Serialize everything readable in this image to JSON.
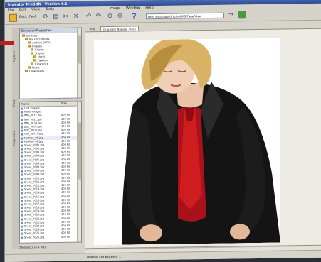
{
  "window": {
    "title": "Ingestor ProSBR - Version 4.1"
  },
  "menu": [
    "File",
    "Edit",
    "View",
    "Tools",
    "Image",
    "Window",
    "Help"
  ],
  "toolbar": {
    "back_label": "Back",
    "forward_label": "Fwd",
    "zoom_value": "Hist: Fit Image Original/MS/Page/View",
    "help_icon": "help-icon"
  },
  "side_tabs": [
    "Explorer",
    "Print",
    "Properties"
  ],
  "tree": {
    "header": "Explorer/Properties",
    "items": [
      "Desktop",
      "My Documents",
      "Archive 2004",
      "Images",
      "Clients",
      "Shoots",
      "Hotel",
      "Fashion",
      "Clearance",
      "Music",
      "Downloads"
    ]
  },
  "files": {
    "columns": [
      "Name",
      "Size"
    ],
    "rows": [
      {
        "name": "Unit Images",
        "size": ""
      },
      {
        "name": "Hotel Images",
        "size": ""
      },
      {
        "name": "IMG_0017.jpg",
        "size": "400 KB"
      },
      {
        "name": "IMG_0021.jpg",
        "size": "400 KB"
      },
      {
        "name": "IMG_0034.jpg",
        "size": "400 KB"
      },
      {
        "name": "Edit_0002.jpg",
        "size": "400 KB"
      },
      {
        "name": "Edit_0003.jpg",
        "size": "400 KB"
      },
      {
        "name": "Clip_00017.jpg",
        "size": "400 KB"
      },
      {
        "name": "Fashion_01.jpg",
        "size": "400 KB"
      },
      {
        "name": "Fashion_02.jpg",
        "size": "400 KB"
      },
      {
        "name": "Shoot_0001.jpg",
        "size": "400 KB"
      },
      {
        "name": "Shoot_0002.jpg",
        "size": "400 KB"
      },
      {
        "name": "Shoot_0003.jpg",
        "size": "400 KB"
      },
      {
        "name": "Shoot_0004.jpg",
        "size": "400 KB"
      },
      {
        "name": "Shoot_0005.jpg",
        "size": "400 KB"
      },
      {
        "name": "Shoot_0006.jpg",
        "size": "400 KB"
      },
      {
        "name": "Shoot_0007.jpg",
        "size": "400 KB"
      },
      {
        "name": "Shoot_0008.jpg",
        "size": "400 KB"
      },
      {
        "name": "Shoot_0009.jpg",
        "size": "400 KB"
      },
      {
        "name": "Shoot_0010.jpg",
        "size": "400 KB"
      },
      {
        "name": "Shoot_0011.jpg",
        "size": "400 KB"
      },
      {
        "name": "Shoot_0012.jpg",
        "size": "400 KB"
      },
      {
        "name": "Shoot_0013.jpg",
        "size": "400 KB"
      },
      {
        "name": "Shoot_0014.jpg",
        "size": "400 KB"
      },
      {
        "name": "Shoot_0015.jpg",
        "size": "400 KB"
      },
      {
        "name": "Shoot_0016.jpg",
        "size": "400 KB"
      },
      {
        "name": "Shoot_0017.jpg",
        "size": "400 KB"
      },
      {
        "name": "Shoot_0018.jpg",
        "size": "400 KB"
      },
      {
        "name": "Shoot_0019.jpg",
        "size": "400 KB"
      },
      {
        "name": "Shoot_0020.jpg",
        "size": "400 KB"
      },
      {
        "name": "Shoot_0021.jpg",
        "size": "400 KB"
      },
      {
        "name": "Shoot_0022.jpg",
        "size": "400 KB"
      },
      {
        "name": "Shoot_0023.jpg",
        "size": "400 KB"
      },
      {
        "name": "Shoot_0024.jpg",
        "size": "400 KB"
      },
      {
        "name": "Shoot_0025.jpg",
        "size": "400 KB"
      },
      {
        "name": "Shoot_0026.jpg",
        "size": "400 KB"
      }
    ]
  },
  "status_left": "36 objects (4.4 MB)",
  "doc_tabs": [
    "Info",
    "Original / Natural / Pics"
  ],
  "status_bar": "Original 4x4 640x480 ...",
  "colors": {
    "accent": "#2c4b93",
    "tie_red": "#c21b1b"
  }
}
